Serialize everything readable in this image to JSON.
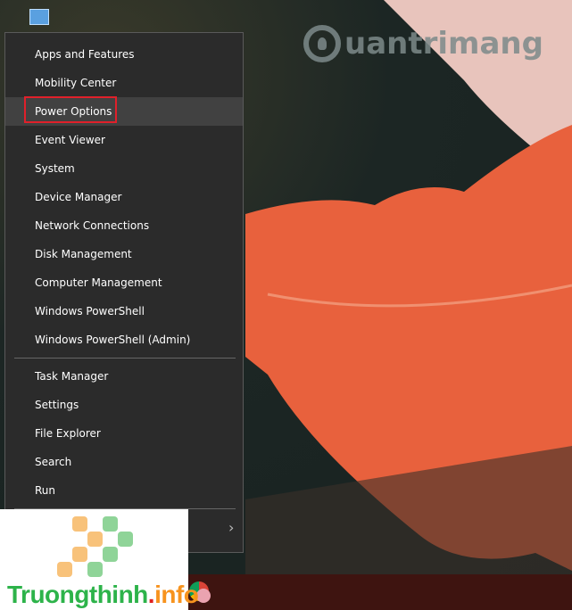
{
  "watermark": "uantrimang",
  "menu": {
    "group1": [
      "Apps and Features",
      "Mobility Center",
      "Power Options",
      "Event Viewer",
      "System",
      "Device Manager",
      "Network Connections",
      "Disk Management",
      "Computer Management",
      "Windows PowerShell",
      "Windows PowerShell (Admin)"
    ],
    "group2": [
      "Task Manager",
      "Settings",
      "File Explorer",
      "Search",
      "Run"
    ],
    "highlighted": "Power Options",
    "submenu_chevron": "›"
  },
  "logo": {
    "name": "Truongthinh",
    "dot": ".",
    "tld": "info"
  },
  "colors": {
    "highlight_box": "#e0202a",
    "arrow": "#e0202a",
    "menu_bg": "#2b2b2b"
  }
}
